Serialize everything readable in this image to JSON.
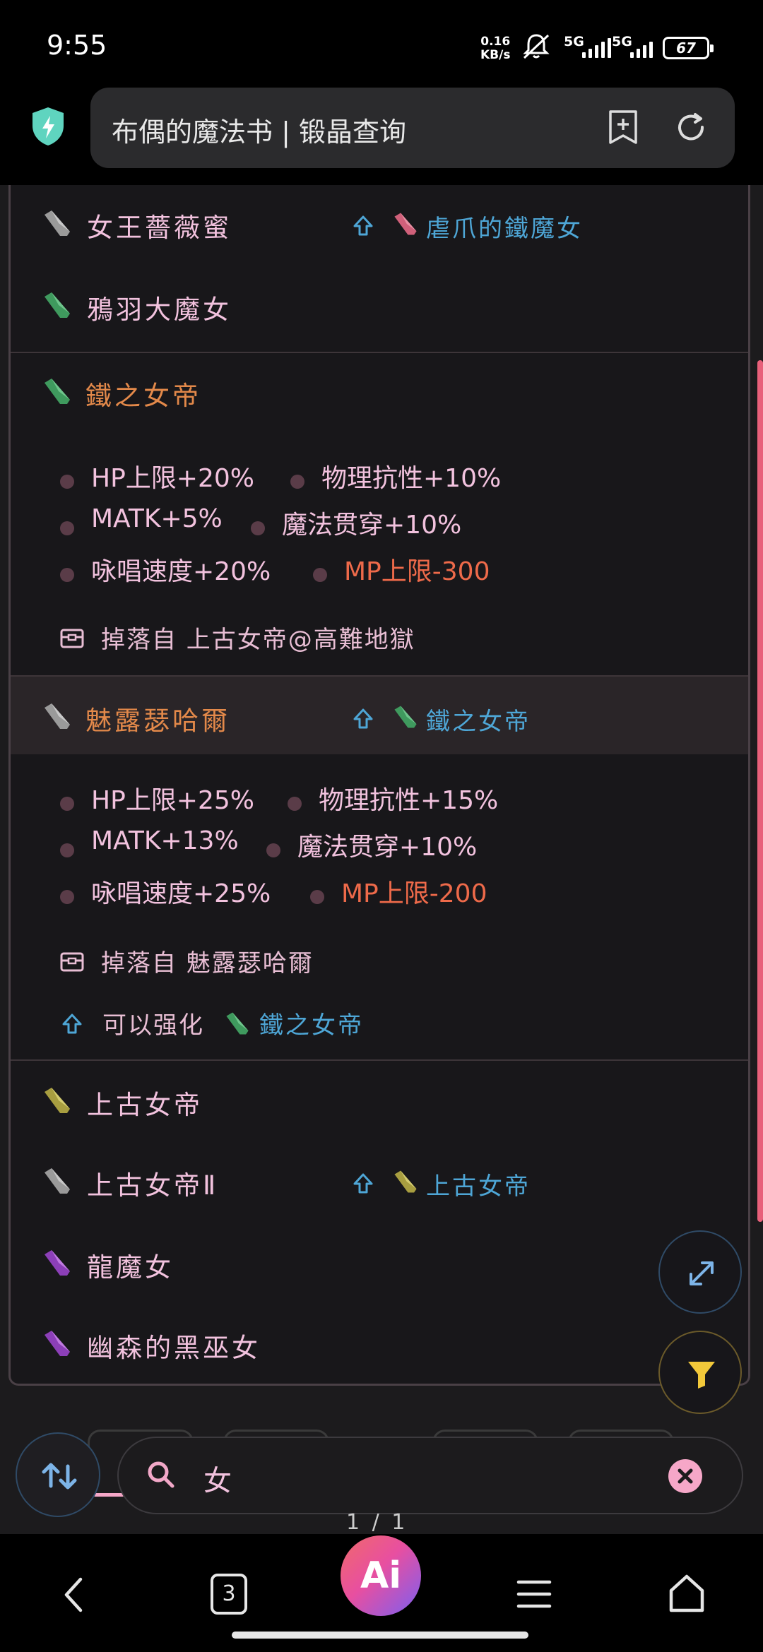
{
  "status": {
    "time": "9:55",
    "speed_top": "0.16",
    "speed_unit": "KB/s",
    "net1": "5G",
    "net2": "5G",
    "battery": "67"
  },
  "browser": {
    "title": "布偶的魔法书 | 锻晶查询"
  },
  "items": [
    {
      "name": "女王薔薇蜜",
      "gem_color": "#9a9a9a",
      "upgrade_from": "虐爪的鐵魔女",
      "upgrade_gem_color": "#d0607a"
    },
    {
      "name": "鴉羽大魔女",
      "gem_color": "#4aa86a"
    },
    {
      "name": "鐵之女帝",
      "gem_color": "#4aa86a",
      "highlight": "orange"
    },
    {
      "name": "魅露瑟哈爾",
      "gem_color": "#9a9a9a",
      "highlight": "orange",
      "upgrade_from": "鐵之女帝",
      "upgrade_gem_color": "#4aa86a"
    },
    {
      "name": "上古女帝",
      "gem_color": "#b8b050"
    },
    {
      "name": "上古女帝Ⅱ",
      "gem_color": "#9a9a9a",
      "upgrade_from": "上古女帝",
      "upgrade_gem_color": "#b8b050"
    },
    {
      "name": "龍魔女",
      "gem_color": "#a04ad0"
    },
    {
      "name": "幽森的黑巫女",
      "gem_color": "#a04ad0"
    }
  ],
  "detail1": {
    "stats": [
      "HP上限+20%",
      "物理抗性+10%",
      "MATK+5%",
      "魔法贯穿+10%",
      "咏唱速度+20%",
      "MP上限-300"
    ],
    "drop": "掉落自 上古女帝@高難地獄"
  },
  "detail2": {
    "stats": [
      "HP上限+25%",
      "物理抗性+15%",
      "MATK+13%",
      "魔法贯穿+10%",
      "咏唱速度+25%",
      "MP上限-200"
    ],
    "drop": "掉落自 魅露瑟哈爾",
    "can_upgrade_label": "可以强化",
    "can_upgrade_target": "鐵之女帝"
  },
  "search": {
    "query": "女",
    "pager": "1 / 1"
  },
  "nav": {
    "tabs_count": "3",
    "ai_label": "Ai"
  },
  "colors": {
    "accent_pink": "#f6a7c8",
    "link_blue": "#4ea6d6",
    "negative": "#ee6a4a",
    "orange": "#e3894a"
  }
}
